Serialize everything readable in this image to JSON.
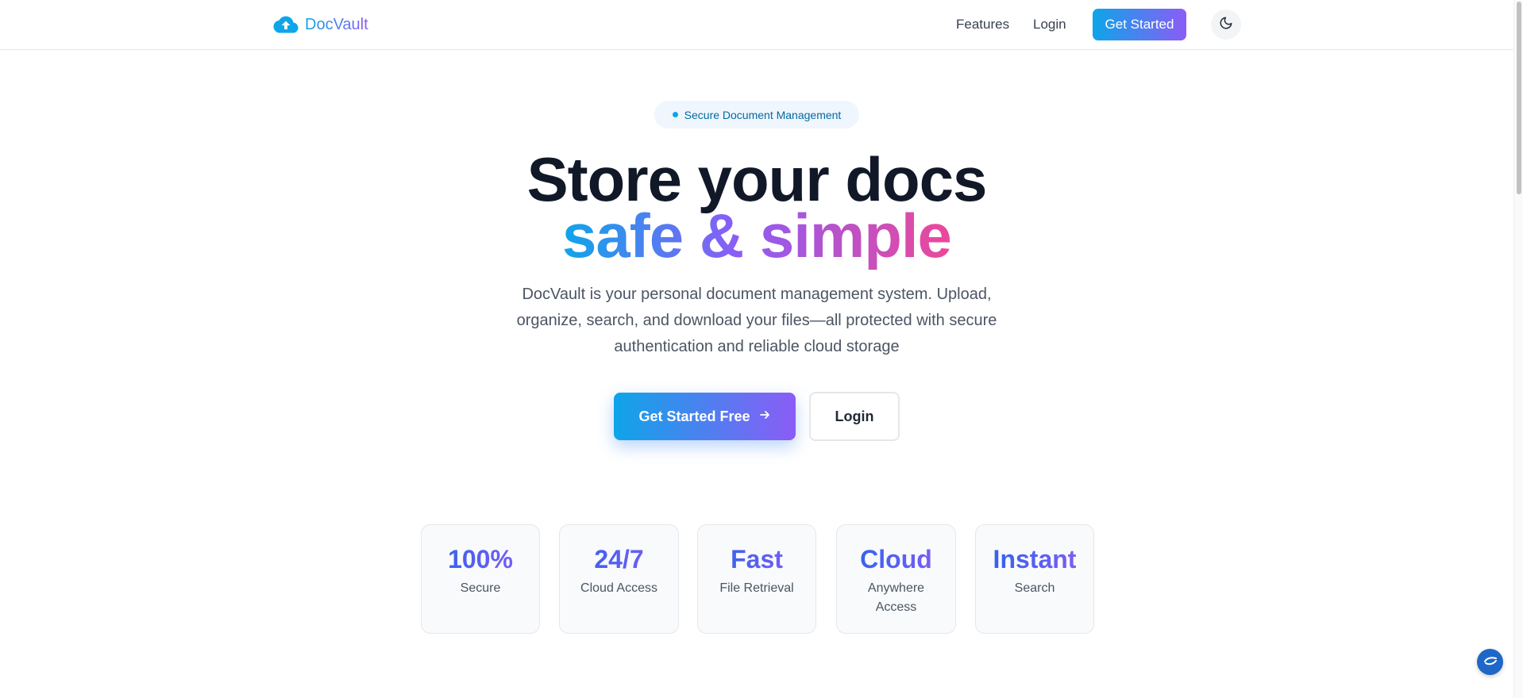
{
  "nav": {
    "brand": "DocVault",
    "logo_icon": "cloud-upload-icon",
    "links": [
      "Features",
      "Login"
    ],
    "cta": "Get Started",
    "theme_icon": "moon-icon"
  },
  "hero": {
    "badge": "Secure Document Management",
    "title_line1": "Store your docs",
    "title_line2": "safe & simple",
    "subtitle": "DocVault is your personal document management system. Upload, organize, search, and download your files—all protected with secure authentication and reliable cloud storage",
    "primary_button": "Get Started Free",
    "primary_icon": "arrow-right-icon",
    "secondary_button": "Login"
  },
  "stats": [
    {
      "value": "100%",
      "label": "Secure"
    },
    {
      "value": "24/7",
      "label": "Cloud Access"
    },
    {
      "value": "Fast",
      "label": "File Retrieval"
    },
    {
      "value": "Cloud",
      "label": "Anywhere Access"
    },
    {
      "value": "Instant",
      "label": "Search"
    }
  ],
  "colors": {
    "accent_start": "#0ea5e9",
    "accent_mid": "#8b5cf6",
    "accent_end": "#ec4899",
    "heading": "#111827"
  },
  "chat_icon": "chat-widget-icon"
}
